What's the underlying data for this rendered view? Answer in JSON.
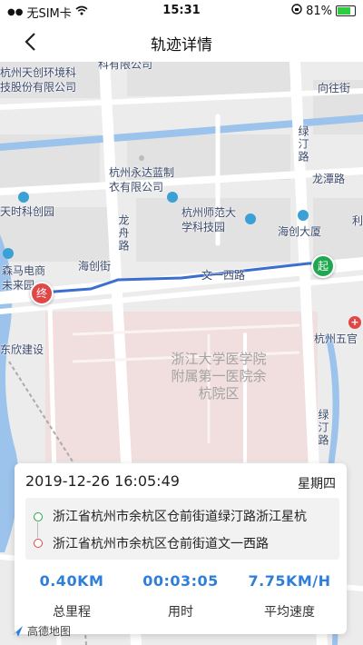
{
  "status": {
    "carrier": "无SIM卡",
    "time": "15:31",
    "battery": "81%",
    "battery_level": 0.81
  },
  "nav": {
    "title": "轨迹详情"
  },
  "map": {
    "labels": {
      "tianchuang": "杭州天创环境科\n技股份有限公司",
      "top_company": "科有限公司",
      "xiangwang_rd": "向往街",
      "lvting_rd_top": "绿汀路",
      "yongda": "杭州永达蓝制\n衣有限公司",
      "longtan_rd": "龙潭路",
      "tianshi": "天时科创园",
      "normal_park": "杭州师范大\n学科技园",
      "longzhou_rd": "龙舟路",
      "haichuang_bldg": "海创大厦",
      "li": "利",
      "senma": "森马电商\n未来园",
      "haichuang_st": "海创街",
      "wenyi_rd": "文一西路",
      "dongxin": "东欣建设",
      "wuchang": "杭州五官",
      "campus": "浙江大学医学院附属第一医院余杭院区",
      "lvting_rd_bottom": "绿汀路"
    },
    "start_marker": "起",
    "end_marker": "终",
    "logo_text": "高德地图"
  },
  "track": {
    "datetime": "2019-12-26 16:05:49",
    "weekday": "星期四",
    "start_address": "浙江省杭州市余杭区仓前街道绿汀路浙江星杭",
    "end_address": "浙江省杭州市余杭区仓前街道文一西路",
    "stats": [
      {
        "value": "0.40KM",
        "caption": "总里程"
      },
      {
        "value": "00:03:05",
        "caption": "用时"
      },
      {
        "value": "7.75KM/H",
        "caption": "平均速度"
      }
    ]
  },
  "colors": {
    "accent": "#2f7fd9",
    "start": "#1fa84f",
    "end": "#e04848",
    "route": "#3a6fd0",
    "river": "#9cc3ec"
  }
}
